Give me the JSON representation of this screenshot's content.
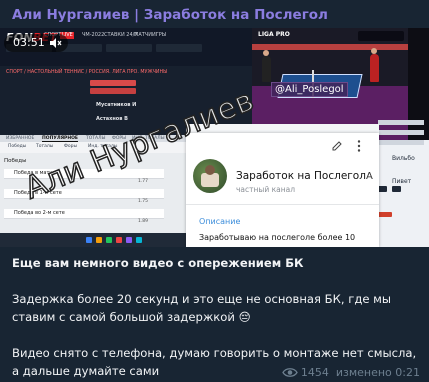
{
  "header": {
    "channel_name": "Али Нургалиев | Заработок на Послегол"
  },
  "video": {
    "time": "03:51",
    "watermark": "Али Нургалиев",
    "handle": "@Ali_Poslegol",
    "bk": {
      "brand_a": "FON",
      "brand_b": "BET",
      "nav": [
        "СПОРТ",
        "LIVE",
        "ЧМ-2022",
        "СТАВКИ 24/7",
        "МАТЧИ",
        "ИГРЫ"
      ],
      "live_header": "СПОРТ / НАСТОЛЬНЫЙ ТЕННИС / РОССИЯ. ЛИГА ПРО. МУЖЧИНЫ",
      "team1": "Мусатников И",
      "team2": "Астахнов В",
      "tabs": [
        "ИЗБРАННОЕ",
        "ПОПУЛЯРНОЕ",
        "ТОТАЛЫ",
        "ФОРЫ",
        "ИНД. ТОТАЛЫ"
      ],
      "chips": [
        "Победы",
        "Тоталы",
        "Форы",
        "Инд. тоталы"
      ],
      "section": "Победы",
      "rows": [
        "Победа в матче",
        "Победа в 1-м сете",
        "Победа во 2-м сете"
      ],
      "odds": [
        "1.77",
        "1.75",
        "1.89"
      ]
    },
    "stream": {
      "logo": "LIGA PRO"
    },
    "side": {
      "label1": "Вильбо",
      "label2": "Пивет"
    },
    "card": {
      "title": "Заработок на Послегол",
      "subtitle": "частный канал",
      "letter": "А",
      "desc_label": "Описание",
      "desc_text": "Заработываю на послеголе более 10"
    }
  },
  "post": {
    "line1": "Еще вам немного видео с опережением БК",
    "line2": "Задержка более 20 секунд и это еще не основная БК, где мы ставим с самой большой задержкой 😔",
    "line3": "Видео снято с телефона, думаю говорить о монтаже нет смысла, а дальше думайте сами"
  },
  "meta": {
    "views": "1454",
    "edited": "изменено 0:21"
  },
  "colors": {
    "channel": "#8b7de0",
    "bubble": "#182533",
    "link": "#3d8edb"
  },
  "icons": [
    "mute-icon",
    "eye-icon",
    "edit-icon",
    "more-icon"
  ]
}
